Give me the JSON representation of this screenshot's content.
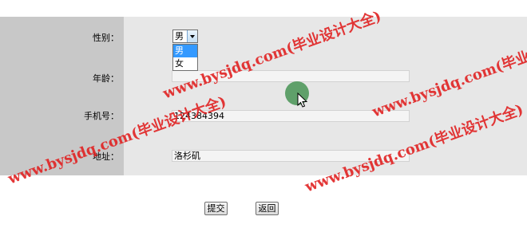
{
  "form": {
    "gender": {
      "label": "性别：",
      "selected": "男",
      "options": [
        "男",
        "女"
      ]
    },
    "age": {
      "label": "年龄：",
      "value": ""
    },
    "phone": {
      "label": "手机号：",
      "value": "124384394"
    },
    "address": {
      "label": "地址：",
      "value": "洛杉矶"
    }
  },
  "buttons": {
    "submit": "提交",
    "back": "返回"
  },
  "watermarks": [
    "www.bysjdq.com(毕业设计大全)",
    "www.bysjdq.com(毕业设计大全)",
    "www.bysjdq.com(毕业设计大全)",
    "www.bysjdq.com(毕业设计大全)"
  ],
  "colors": {
    "label_column": "#c8c8c8",
    "form_background": "#e7e7e7",
    "watermark": "#e12222",
    "dropdown_highlight": "#3399ff"
  }
}
